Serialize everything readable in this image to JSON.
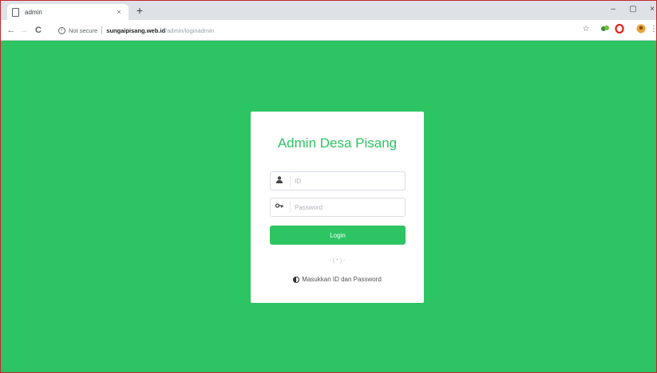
{
  "browser": {
    "tab_title": "admin",
    "tab_close": "×",
    "new_tab": "+",
    "window_controls": {
      "minimize": "–",
      "maximize": "▢",
      "close": "×"
    },
    "nav": {
      "back": "←",
      "forward": "→",
      "reload": "C"
    },
    "address": {
      "security_label": "Not secure",
      "host": "sungaipisang.web.id",
      "path": "/admin/loginadmin"
    },
    "toolbar_icons": [
      "star-icon",
      "extension-icon",
      "opera-icon",
      "profile-avatar-icon"
    ]
  },
  "login": {
    "title": "Admin Desa Pisang",
    "id_placeholder": "ID",
    "password_placeholder": "Password",
    "login_label": "Login",
    "divider": "- ( * ) -",
    "hint": "Masukkan ID dan Password"
  },
  "colors": {
    "background": "#2dc463",
    "accent": "#2dc463"
  }
}
